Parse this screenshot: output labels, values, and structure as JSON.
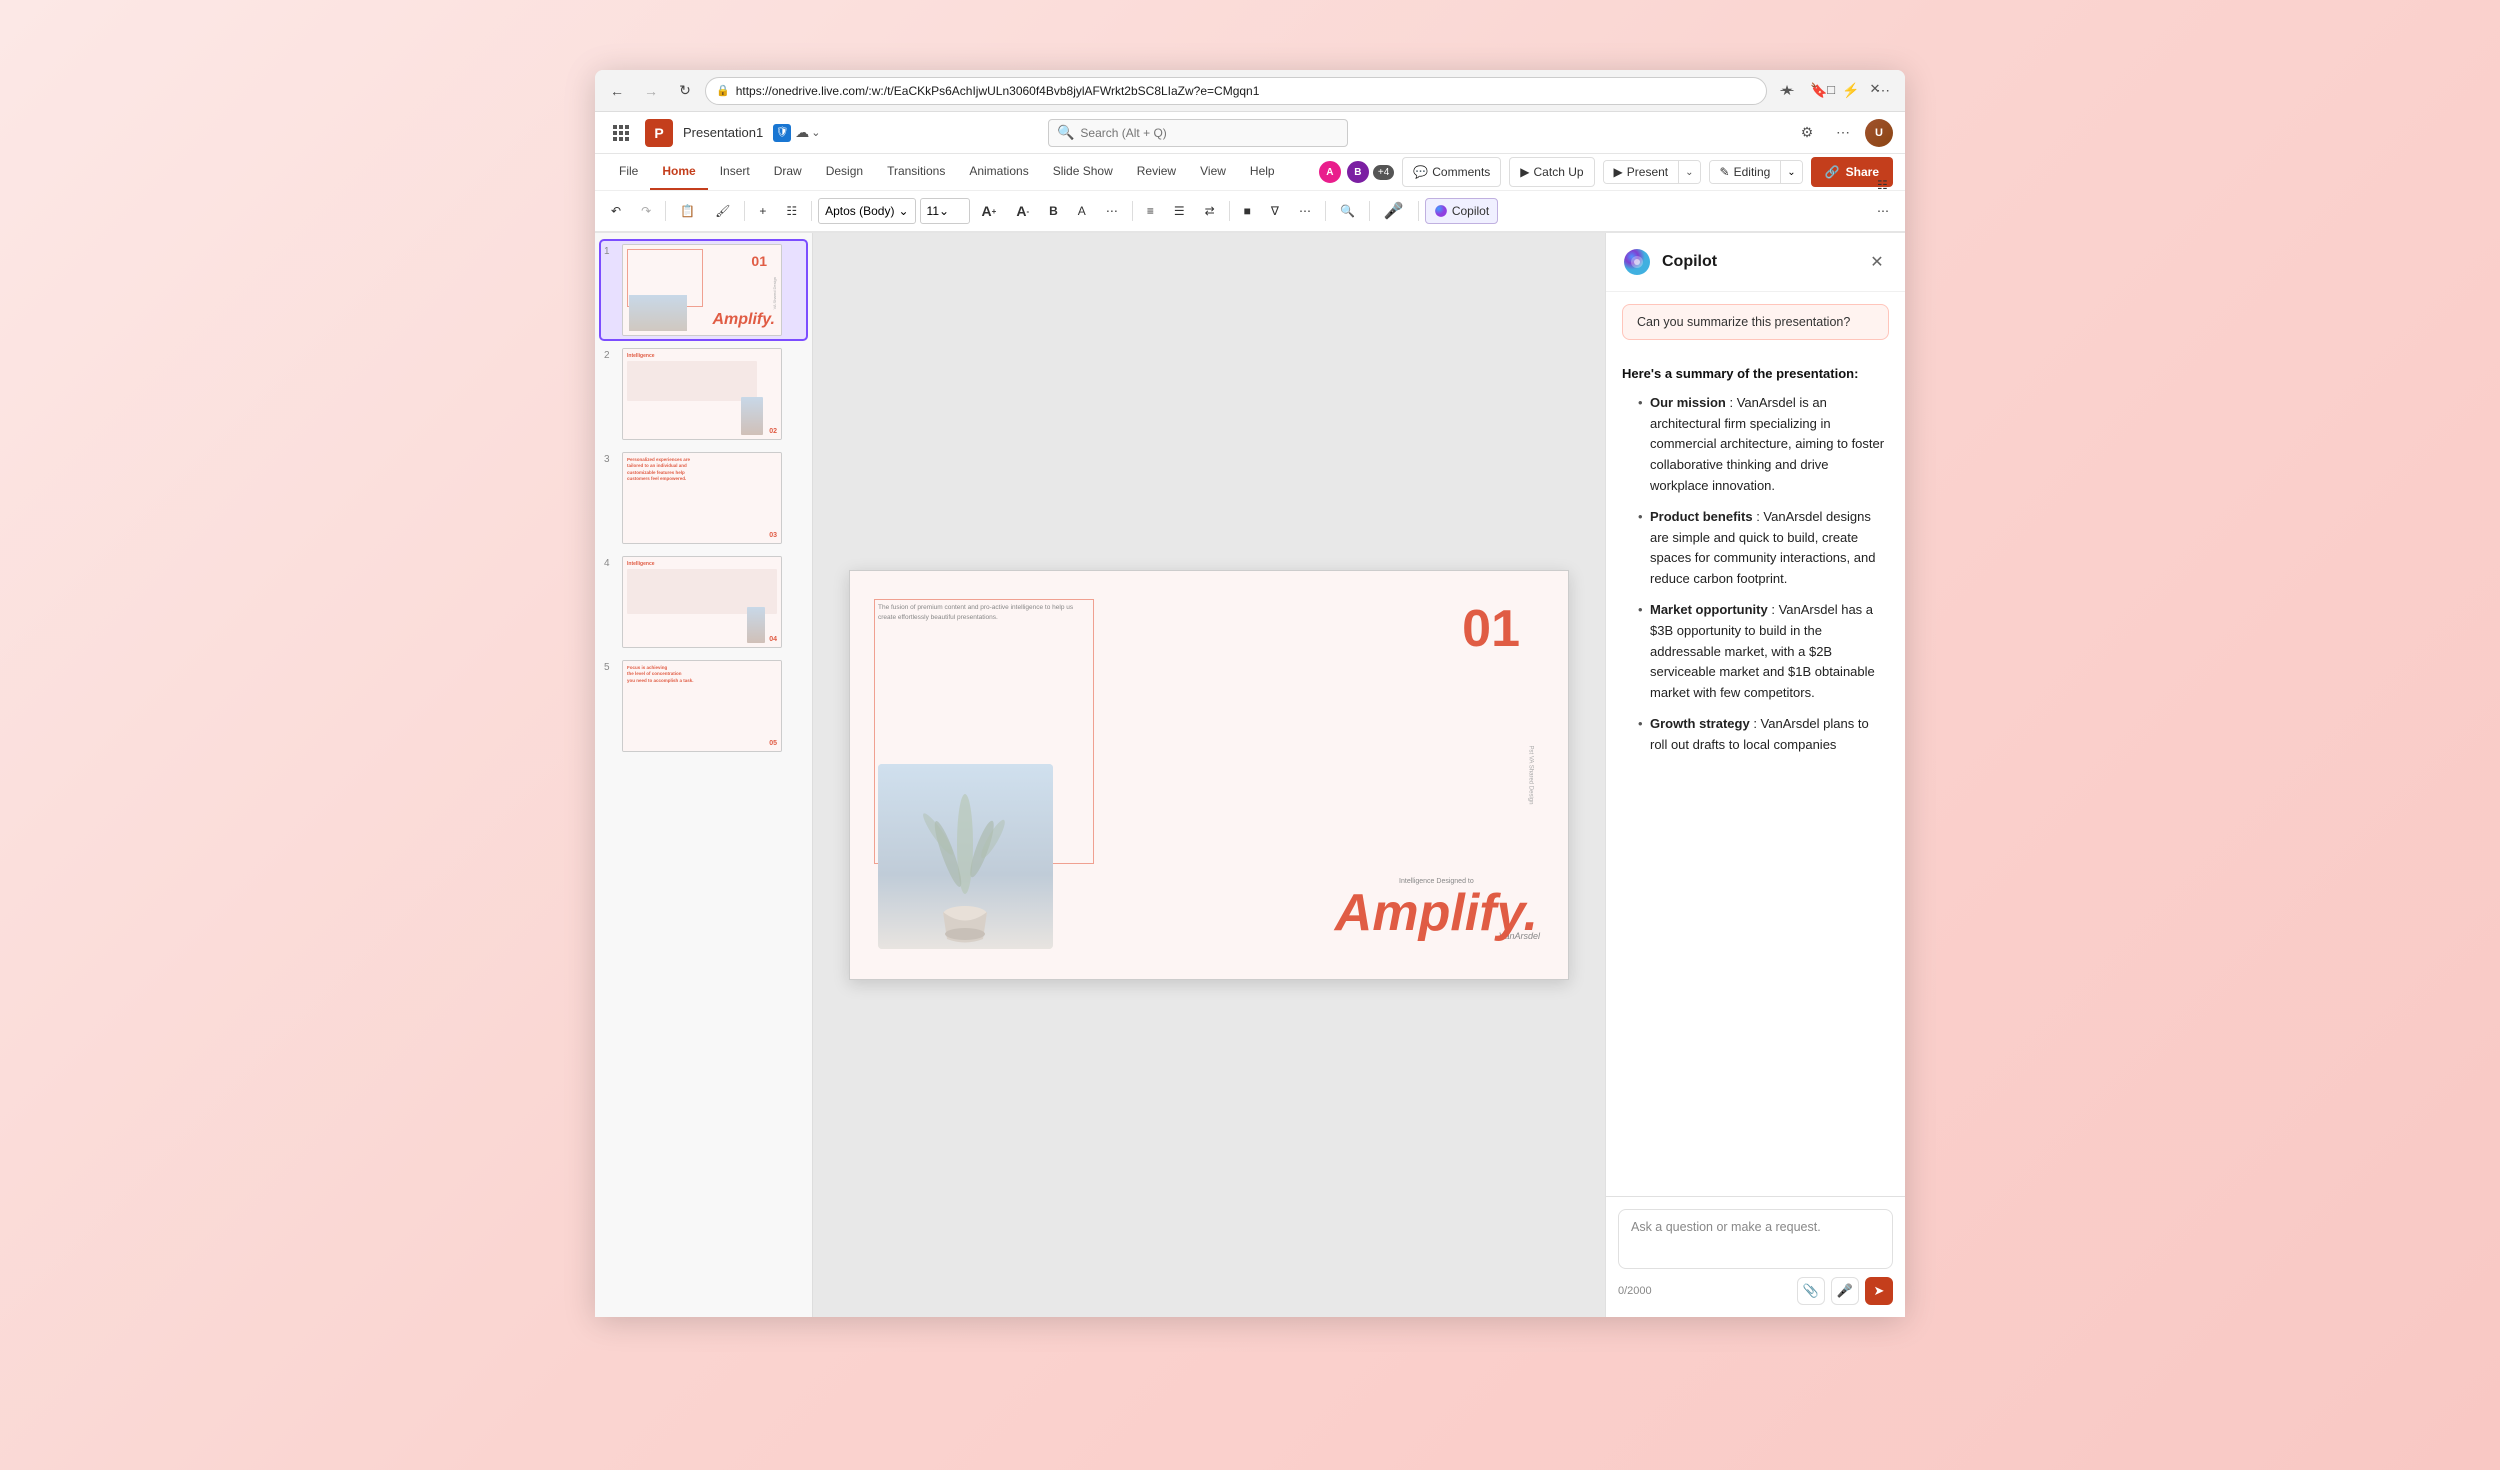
{
  "browser": {
    "url": "https://onedrive.live.com/:w:/t/EaCKkPs6AchIjwULn3060f4Bvb8jylAFWrkt2bSC8LIaZw?e=CMgqn1",
    "search_placeholder": "Search (Alt + Q)"
  },
  "app": {
    "logo_letter": "P",
    "title": "Presentation1",
    "save_status": "Saved to OneDrive"
  },
  "tabs": {
    "file": "File",
    "home": "Home",
    "insert": "Insert",
    "draw": "Draw",
    "design": "Design",
    "transitions": "Transitions",
    "animations": "Animations",
    "slide_show": "Slide Show",
    "review": "Review",
    "view": "View",
    "help": "Help"
  },
  "toolbar": {
    "comments_label": "Comments",
    "catch_up_label": "Catch Up",
    "present_label": "Present",
    "editing_label": "Editing",
    "share_label": "Share",
    "copilot_label": "Copilot",
    "font_name": "Aptos (Body)",
    "font_size": "11"
  },
  "copilot": {
    "title": "Copilot",
    "suggestion": "Can you summarize this presentation?",
    "summary_intro": "Here's a summary of the presentation:",
    "bullet1_label": "Our mission",
    "bullet1_text": ": VanArsdel is an architectural firm specializing in commercial architecture, aiming to foster collaborative thinking and drive workplace innovation.",
    "bullet2_label": "Product benefits",
    "bullet2_text": ": VanArsdel designs are simple and quick to build, create spaces for community interactions, and reduce carbon footprint.",
    "bullet3_label": "Market opportunity",
    "bullet3_text": ": VanArsdel has a $3B opportunity to build in the addressable market, with a $2B serviceable market and $1B obtainable market with few competitors.",
    "bullet4_label": "Growth strategy",
    "bullet4_text": ": VanArsdel plans to roll out drafts to local companies",
    "input_placeholder": "Ask a question or make a request.",
    "char_count": "0/2000"
  },
  "slide1": {
    "number": "01",
    "text": "The fusion of premium content and pro-active intelligence to help us create effortlessly beautiful presentations.",
    "brand": "VanArsdel",
    "amplify_small": "Intelligence Designed to",
    "amplify_big": "Amplify.",
    "vertical_text": "Pst  VA Shared Design"
  },
  "slides": [
    {
      "num": "1",
      "label": "Amplify title slide"
    },
    {
      "num": "2",
      "label": "Intelligence slide"
    },
    {
      "num": "3",
      "label": "Personalized experiences slide"
    },
    {
      "num": "4",
      "label": "Intelligence data slide"
    },
    {
      "num": "5",
      "label": "Focus slide"
    }
  ]
}
